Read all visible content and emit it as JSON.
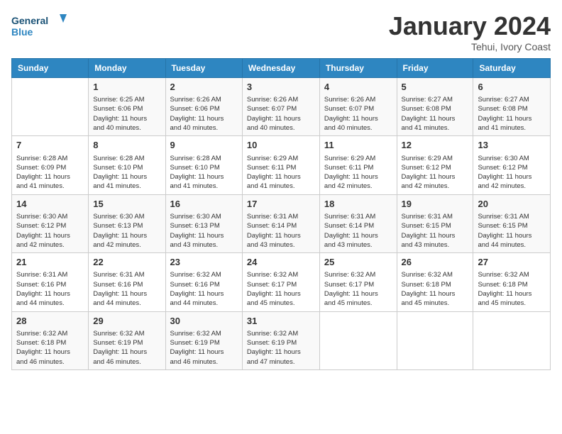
{
  "logo": {
    "text_general": "General",
    "text_blue": "Blue"
  },
  "title": "January 2024",
  "subtitle": "Tehui, Ivory Coast",
  "days_of_week": [
    "Sunday",
    "Monday",
    "Tuesday",
    "Wednesday",
    "Thursday",
    "Friday",
    "Saturday"
  ],
  "weeks": [
    [
      {
        "day": "",
        "info": ""
      },
      {
        "day": "1",
        "info": "Sunrise: 6:25 AM\nSunset: 6:06 PM\nDaylight: 11 hours\nand 40 minutes."
      },
      {
        "day": "2",
        "info": "Sunrise: 6:26 AM\nSunset: 6:06 PM\nDaylight: 11 hours\nand 40 minutes."
      },
      {
        "day": "3",
        "info": "Sunrise: 6:26 AM\nSunset: 6:07 PM\nDaylight: 11 hours\nand 40 minutes."
      },
      {
        "day": "4",
        "info": "Sunrise: 6:26 AM\nSunset: 6:07 PM\nDaylight: 11 hours\nand 40 minutes."
      },
      {
        "day": "5",
        "info": "Sunrise: 6:27 AM\nSunset: 6:08 PM\nDaylight: 11 hours\nand 41 minutes."
      },
      {
        "day": "6",
        "info": "Sunrise: 6:27 AM\nSunset: 6:08 PM\nDaylight: 11 hours\nand 41 minutes."
      }
    ],
    [
      {
        "day": "7",
        "info": "Sunrise: 6:28 AM\nSunset: 6:09 PM\nDaylight: 11 hours\nand 41 minutes."
      },
      {
        "day": "8",
        "info": "Sunrise: 6:28 AM\nSunset: 6:10 PM\nDaylight: 11 hours\nand 41 minutes."
      },
      {
        "day": "9",
        "info": "Sunrise: 6:28 AM\nSunset: 6:10 PM\nDaylight: 11 hours\nand 41 minutes."
      },
      {
        "day": "10",
        "info": "Sunrise: 6:29 AM\nSunset: 6:11 PM\nDaylight: 11 hours\nand 41 minutes."
      },
      {
        "day": "11",
        "info": "Sunrise: 6:29 AM\nSunset: 6:11 PM\nDaylight: 11 hours\nand 42 minutes."
      },
      {
        "day": "12",
        "info": "Sunrise: 6:29 AM\nSunset: 6:12 PM\nDaylight: 11 hours\nand 42 minutes."
      },
      {
        "day": "13",
        "info": "Sunrise: 6:30 AM\nSunset: 6:12 PM\nDaylight: 11 hours\nand 42 minutes."
      }
    ],
    [
      {
        "day": "14",
        "info": "Sunrise: 6:30 AM\nSunset: 6:12 PM\nDaylight: 11 hours\nand 42 minutes."
      },
      {
        "day": "15",
        "info": "Sunrise: 6:30 AM\nSunset: 6:13 PM\nDaylight: 11 hours\nand 42 minutes."
      },
      {
        "day": "16",
        "info": "Sunrise: 6:30 AM\nSunset: 6:13 PM\nDaylight: 11 hours\nand 43 minutes."
      },
      {
        "day": "17",
        "info": "Sunrise: 6:31 AM\nSunset: 6:14 PM\nDaylight: 11 hours\nand 43 minutes."
      },
      {
        "day": "18",
        "info": "Sunrise: 6:31 AM\nSunset: 6:14 PM\nDaylight: 11 hours\nand 43 minutes."
      },
      {
        "day": "19",
        "info": "Sunrise: 6:31 AM\nSunset: 6:15 PM\nDaylight: 11 hours\nand 43 minutes."
      },
      {
        "day": "20",
        "info": "Sunrise: 6:31 AM\nSunset: 6:15 PM\nDaylight: 11 hours\nand 44 minutes."
      }
    ],
    [
      {
        "day": "21",
        "info": "Sunrise: 6:31 AM\nSunset: 6:16 PM\nDaylight: 11 hours\nand 44 minutes."
      },
      {
        "day": "22",
        "info": "Sunrise: 6:31 AM\nSunset: 6:16 PM\nDaylight: 11 hours\nand 44 minutes."
      },
      {
        "day": "23",
        "info": "Sunrise: 6:32 AM\nSunset: 6:16 PM\nDaylight: 11 hours\nand 44 minutes."
      },
      {
        "day": "24",
        "info": "Sunrise: 6:32 AM\nSunset: 6:17 PM\nDaylight: 11 hours\nand 45 minutes."
      },
      {
        "day": "25",
        "info": "Sunrise: 6:32 AM\nSunset: 6:17 PM\nDaylight: 11 hours\nand 45 minutes."
      },
      {
        "day": "26",
        "info": "Sunrise: 6:32 AM\nSunset: 6:18 PM\nDaylight: 11 hours\nand 45 minutes."
      },
      {
        "day": "27",
        "info": "Sunrise: 6:32 AM\nSunset: 6:18 PM\nDaylight: 11 hours\nand 45 minutes."
      }
    ],
    [
      {
        "day": "28",
        "info": "Sunrise: 6:32 AM\nSunset: 6:18 PM\nDaylight: 11 hours\nand 46 minutes."
      },
      {
        "day": "29",
        "info": "Sunrise: 6:32 AM\nSunset: 6:19 PM\nDaylight: 11 hours\nand 46 minutes."
      },
      {
        "day": "30",
        "info": "Sunrise: 6:32 AM\nSunset: 6:19 PM\nDaylight: 11 hours\nand 46 minutes."
      },
      {
        "day": "31",
        "info": "Sunrise: 6:32 AM\nSunset: 6:19 PM\nDaylight: 11 hours\nand 47 minutes."
      },
      {
        "day": "",
        "info": ""
      },
      {
        "day": "",
        "info": ""
      },
      {
        "day": "",
        "info": ""
      }
    ]
  ]
}
